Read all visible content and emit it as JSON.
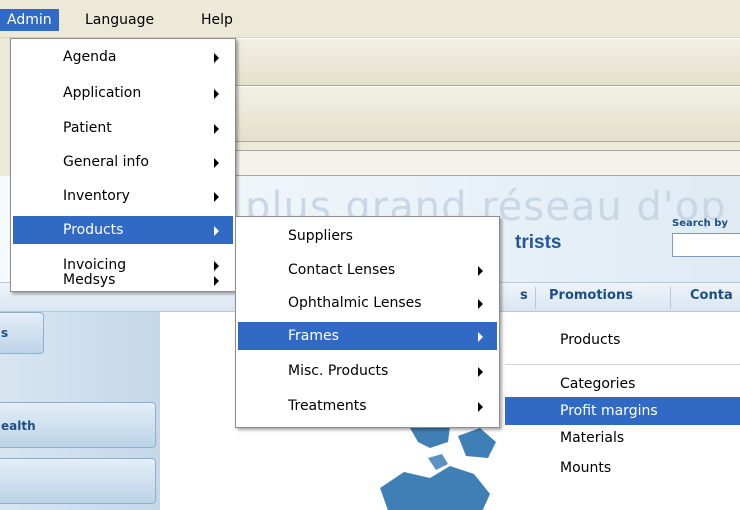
{
  "menubar": {
    "items": [
      {
        "label": "Admin",
        "active": true
      },
      {
        "label": "Language",
        "active": false
      },
      {
        "label": "Help",
        "active": false
      }
    ]
  },
  "admin_menu": {
    "items": [
      {
        "label": "Agenda",
        "submenu": true,
        "highlighted": false
      },
      {
        "label": "Application",
        "submenu": true,
        "highlighted": false
      },
      {
        "label": "Patient",
        "submenu": true,
        "highlighted": false
      },
      {
        "label": "General info",
        "submenu": true,
        "highlighted": false
      },
      {
        "label": "Inventory",
        "submenu": true,
        "highlighted": false
      },
      {
        "label": "Products",
        "submenu": true,
        "highlighted": true
      },
      {
        "label": "Invoicing",
        "submenu": true,
        "highlighted": false
      },
      {
        "label": "Medsys",
        "submenu": true,
        "highlighted": false
      }
    ]
  },
  "products_menu": {
    "items": [
      {
        "label": "Suppliers",
        "submenu": false,
        "highlighted": false
      },
      {
        "label": "Contact Lenses",
        "submenu": true,
        "highlighted": false
      },
      {
        "label": "Ophthalmic Lenses",
        "submenu": true,
        "highlighted": false
      },
      {
        "label": "Frames",
        "submenu": true,
        "highlighted": true
      },
      {
        "label": "Misc. Products",
        "submenu": true,
        "highlighted": false
      },
      {
        "label": "Treatments",
        "submenu": true,
        "highlighted": false
      }
    ]
  },
  "frames_dropdown": {
    "items": [
      {
        "label": "Products",
        "highlighted": false
      },
      {
        "label": "Categories",
        "highlighted": false
      },
      {
        "label": "Profit margins",
        "highlighted": true
      },
      {
        "label": "Materials",
        "highlighted": false
      },
      {
        "label": "Mounts",
        "highlighted": false
      }
    ]
  },
  "webpage": {
    "watermark": "plus grand réseau d'op",
    "brand_fragment": "trists",
    "search_label": "Search by",
    "nav_tabs": [
      "s",
      "Promotions",
      "Conta"
    ],
    "left_buttons": [
      "s",
      "ealth",
      ""
    ]
  },
  "colors": {
    "highlight": "#316ac5",
    "menubar_bg": "#ece9d8",
    "nav_text": "#1e4f82"
  }
}
